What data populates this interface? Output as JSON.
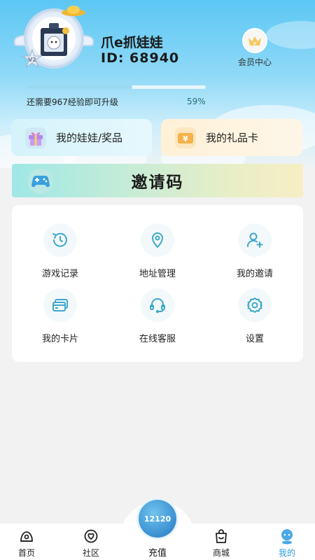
{
  "profile": {
    "username": "爪e抓娃娃",
    "id_text": "ID: 68940",
    "vip_level": "V2",
    "vip_center_label": "会员中心"
  },
  "progress": {
    "text": "还需要967经验即可升级",
    "percent_text": "59%",
    "percent": 59
  },
  "cards": {
    "dolls_label": "我的娃娃/奖品",
    "gift_label": "我的礼品卡",
    "gift_icon_char": "¥"
  },
  "invite": {
    "label": "邀请码"
  },
  "menu": {
    "items": [
      {
        "label": "游戏记录",
        "icon": "history-icon"
      },
      {
        "label": "地址管理",
        "icon": "location-pin-icon"
      },
      {
        "label": "我的邀请",
        "icon": "add-user-icon"
      },
      {
        "label": "我的卡片",
        "icon": "cards-icon"
      },
      {
        "label": "在线客服",
        "icon": "headset-icon"
      },
      {
        "label": "设置",
        "icon": "gear-icon"
      }
    ]
  },
  "nav": {
    "items": [
      {
        "label": "首页",
        "icon": "home-icon"
      },
      {
        "label": "社区",
        "icon": "community-icon"
      },
      {
        "label": "充值",
        "icon": "recharge-coin-icon"
      },
      {
        "label": "商城",
        "icon": "shopping-bag-icon"
      },
      {
        "label": "我的",
        "icon": "profile-icon"
      }
    ],
    "recharge_coin_text": "12120",
    "active": "我的"
  },
  "colors": {
    "accent_blue": "#2f9ed8",
    "header_top": "#5cc7f4",
    "icon_teal": "#3ea7c7"
  }
}
